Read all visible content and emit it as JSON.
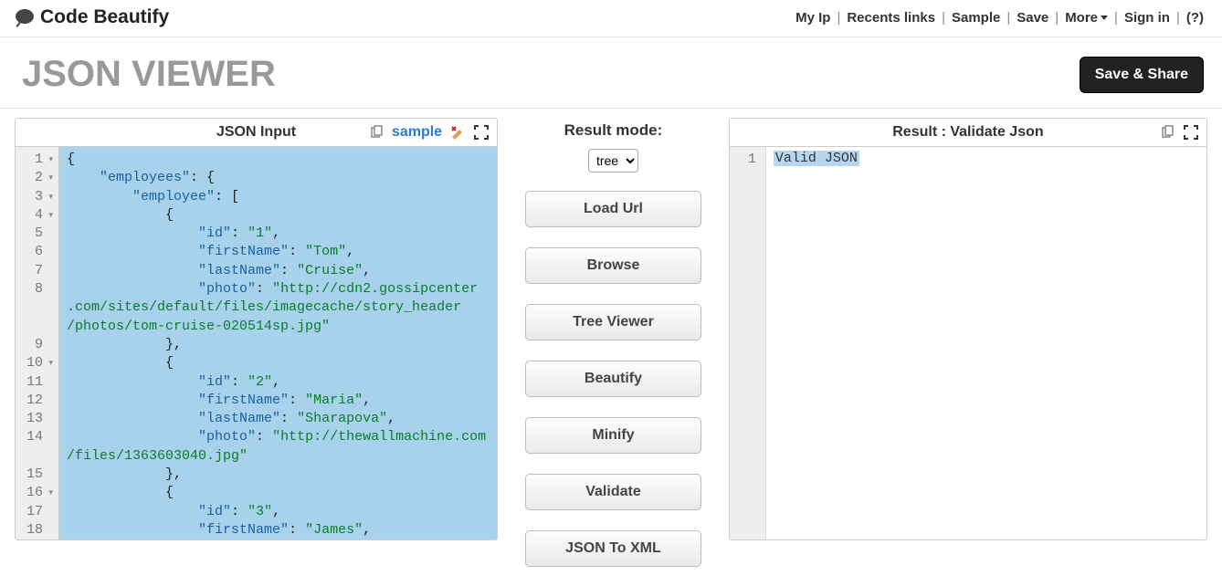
{
  "header": {
    "logo_text": "Code Beautify",
    "nav": {
      "my_ip": "My Ip",
      "recents": "Recents links",
      "sample": "Sample",
      "save": "Save",
      "more": "More",
      "sign_in": "Sign in",
      "help": "(?)"
    }
  },
  "title": "JSON VIEWER",
  "save_share": "Save & Share",
  "left": {
    "header": "JSON Input",
    "sample_link": "sample",
    "gutter": [
      "1",
      "2",
      "3",
      "4",
      "5",
      "6",
      "7",
      "8",
      "9",
      "10",
      "11",
      "12",
      "13",
      "14",
      "15",
      "16",
      "17",
      "18"
    ],
    "gutter_fold": [
      true,
      true,
      true,
      true,
      false,
      false,
      false,
      false,
      false,
      true,
      false,
      false,
      false,
      false,
      false,
      true,
      false,
      false
    ],
    "code_lines": [
      [
        {
          "t": "p",
          "v": "{"
        }
      ],
      [
        {
          "t": "sp",
          "v": "    "
        },
        {
          "t": "k",
          "v": "\"employees\""
        },
        {
          "t": "p",
          "v": ": {"
        }
      ],
      [
        {
          "t": "sp",
          "v": "        "
        },
        {
          "t": "k",
          "v": "\"employee\""
        },
        {
          "t": "p",
          "v": ": ["
        }
      ],
      [
        {
          "t": "sp",
          "v": "            "
        },
        {
          "t": "p",
          "v": "{"
        }
      ],
      [
        {
          "t": "sp",
          "v": "                "
        },
        {
          "t": "k",
          "v": "\"id\""
        },
        {
          "t": "p",
          "v": ": "
        },
        {
          "t": "s",
          "v": "\"1\""
        },
        {
          "t": "p",
          "v": ","
        }
      ],
      [
        {
          "t": "sp",
          "v": "                "
        },
        {
          "t": "k",
          "v": "\"firstName\""
        },
        {
          "t": "p",
          "v": ": "
        },
        {
          "t": "s",
          "v": "\"Tom\""
        },
        {
          "t": "p",
          "v": ","
        }
      ],
      [
        {
          "t": "sp",
          "v": "                "
        },
        {
          "t": "k",
          "v": "\"lastName\""
        },
        {
          "t": "p",
          "v": ": "
        },
        {
          "t": "s",
          "v": "\"Cruise\""
        },
        {
          "t": "p",
          "v": ","
        }
      ],
      [
        {
          "t": "sp",
          "v": "                "
        },
        {
          "t": "k",
          "v": "\"photo\""
        },
        {
          "t": "p",
          "v": ": "
        },
        {
          "t": "s",
          "v": "\"http://cdn2.gossipcenter"
        }
      ],
      [
        {
          "t": "sp",
          "v": "            "
        },
        {
          "t": "p",
          "v": "},"
        }
      ],
      [
        {
          "t": "sp",
          "v": "            "
        },
        {
          "t": "p",
          "v": "{"
        }
      ],
      [
        {
          "t": "sp",
          "v": "                "
        },
        {
          "t": "k",
          "v": "\"id\""
        },
        {
          "t": "p",
          "v": ": "
        },
        {
          "t": "s",
          "v": "\"2\""
        },
        {
          "t": "p",
          "v": ","
        }
      ],
      [
        {
          "t": "sp",
          "v": "                "
        },
        {
          "t": "k",
          "v": "\"firstName\""
        },
        {
          "t": "p",
          "v": ": "
        },
        {
          "t": "s",
          "v": "\"Maria\""
        },
        {
          "t": "p",
          "v": ","
        }
      ],
      [
        {
          "t": "sp",
          "v": "                "
        },
        {
          "t": "k",
          "v": "\"lastName\""
        },
        {
          "t": "p",
          "v": ": "
        },
        {
          "t": "s",
          "v": "\"Sharapova\""
        },
        {
          "t": "p",
          "v": ","
        }
      ],
      [
        {
          "t": "sp",
          "v": "                "
        },
        {
          "t": "k",
          "v": "\"photo\""
        },
        {
          "t": "p",
          "v": ": "
        },
        {
          "t": "s",
          "v": "\"http://thewallmachine.com"
        }
      ],
      [
        {
          "t": "sp",
          "v": "            "
        },
        {
          "t": "p",
          "v": "},"
        }
      ],
      [
        {
          "t": "sp",
          "v": "            "
        },
        {
          "t": "p",
          "v": "{"
        }
      ],
      [
        {
          "t": "sp",
          "v": "                "
        },
        {
          "t": "k",
          "v": "\"id\""
        },
        {
          "t": "p",
          "v": ": "
        },
        {
          "t": "s",
          "v": "\"3\""
        },
        {
          "t": "p",
          "v": ","
        }
      ],
      [
        {
          "t": "sp",
          "v": "                "
        },
        {
          "t": "k",
          "v": "\"firstName\""
        },
        {
          "t": "p",
          "v": ": "
        },
        {
          "t": "s",
          "v": "\"James\""
        },
        {
          "t": "p",
          "v": ","
        }
      ]
    ],
    "wrap1a": ".com/sites/default/files/imagecache/story_header",
    "wrap1b": "/photos/tom-cruise-020514sp.jpg\"",
    "wrap2": "/files/1363603040.jpg\""
  },
  "mid": {
    "header": "Result mode:",
    "select_value": "tree",
    "buttons": {
      "load_url": "Load Url",
      "browse": "Browse",
      "tree_viewer": "Tree Viewer",
      "beautify": "Beautify",
      "minify": "Minify",
      "validate": "Validate",
      "json_to_xml": "JSON To XML"
    }
  },
  "right": {
    "header": "Result : Validate Json",
    "line_num": "1",
    "result_text": "Valid JSON"
  }
}
